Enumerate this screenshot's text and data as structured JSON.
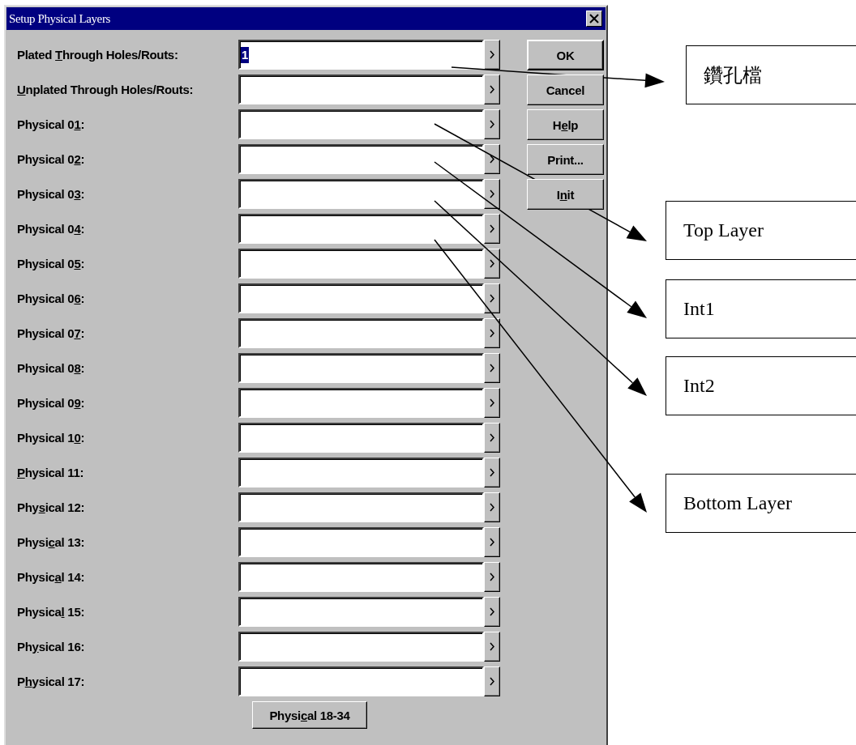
{
  "window": {
    "title": "Setup Physical Layers"
  },
  "rows": [
    {
      "label": {
        "pre": "Plated ",
        "key": "T",
        "post": "hrough Holes/Routs:"
      },
      "value": "1",
      "value_selected": true
    },
    {
      "label": {
        "key": "U",
        "post": "nplated Through Holes/Routs:"
      }
    },
    {
      "label": {
        "pre": "Physical 0",
        "key": "1",
        "post": ":"
      }
    },
    {
      "label": {
        "pre": "Physical 0",
        "key": "2",
        "post": ":"
      }
    },
    {
      "label": {
        "pre": "Physical 0",
        "key": "3",
        "post": ":"
      }
    },
    {
      "label": {
        "pre": "Physical 0",
        "key": "4",
        "post": ":"
      }
    },
    {
      "label": {
        "pre": "Physical 0",
        "key": "5",
        "post": ":"
      }
    },
    {
      "label": {
        "pre": "Physical 0",
        "key": "6",
        "post": ":"
      }
    },
    {
      "label": {
        "pre": "Physical 0",
        "key": "7",
        "post": ":"
      }
    },
    {
      "label": {
        "pre": "Physical 0",
        "key": "8",
        "post": ":"
      }
    },
    {
      "label": {
        "pre": "Physical 0",
        "key": "9",
        "post": ":"
      }
    },
    {
      "label": {
        "pre": "Physical 1",
        "key": "0",
        "post": ":"
      }
    },
    {
      "label": {
        "key": "P",
        "post": "hysical 11:"
      }
    },
    {
      "label": {
        "pre": "Phy",
        "key": "s",
        "post": "ical 12:"
      }
    },
    {
      "label": {
        "pre": "Physi",
        "key": "c",
        "post": "al 13:"
      }
    },
    {
      "label": {
        "pre": "Physic",
        "key": "a",
        "post": "l 14:"
      }
    },
    {
      "label": {
        "pre": "Physica",
        "key": "l",
        "post": " 15:"
      }
    },
    {
      "label": {
        "pre": "Ph",
        "key": "y",
        "post": "sical 16:"
      }
    },
    {
      "label": {
        "pre": "P",
        "key": "h",
        "post": "ysical 17:"
      }
    }
  ],
  "buttons": [
    {
      "label": {
        "post": "OK"
      },
      "default": true
    },
    {
      "label": {
        "post": "Cancel"
      },
      "default": false
    },
    {
      "label": {
        "pre": "H",
        "key": "e",
        "post": "lp"
      },
      "default": false
    },
    {
      "label": {
        "post": "Print..."
      },
      "default": false
    },
    {
      "label": {
        "pre": "I",
        "key": "n",
        "post": "it"
      },
      "default": false
    }
  ],
  "more_button": {
    "label": {
      "pre": "Physi",
      "key": "c",
      "post": "al 18-34"
    }
  },
  "annotations": [
    {
      "text": "鑽孔檔"
    },
    {
      "text": "Top Layer"
    },
    {
      "text": "Int1"
    },
    {
      "text": "Int2"
    },
    {
      "text": "Bottom Layer"
    }
  ]
}
